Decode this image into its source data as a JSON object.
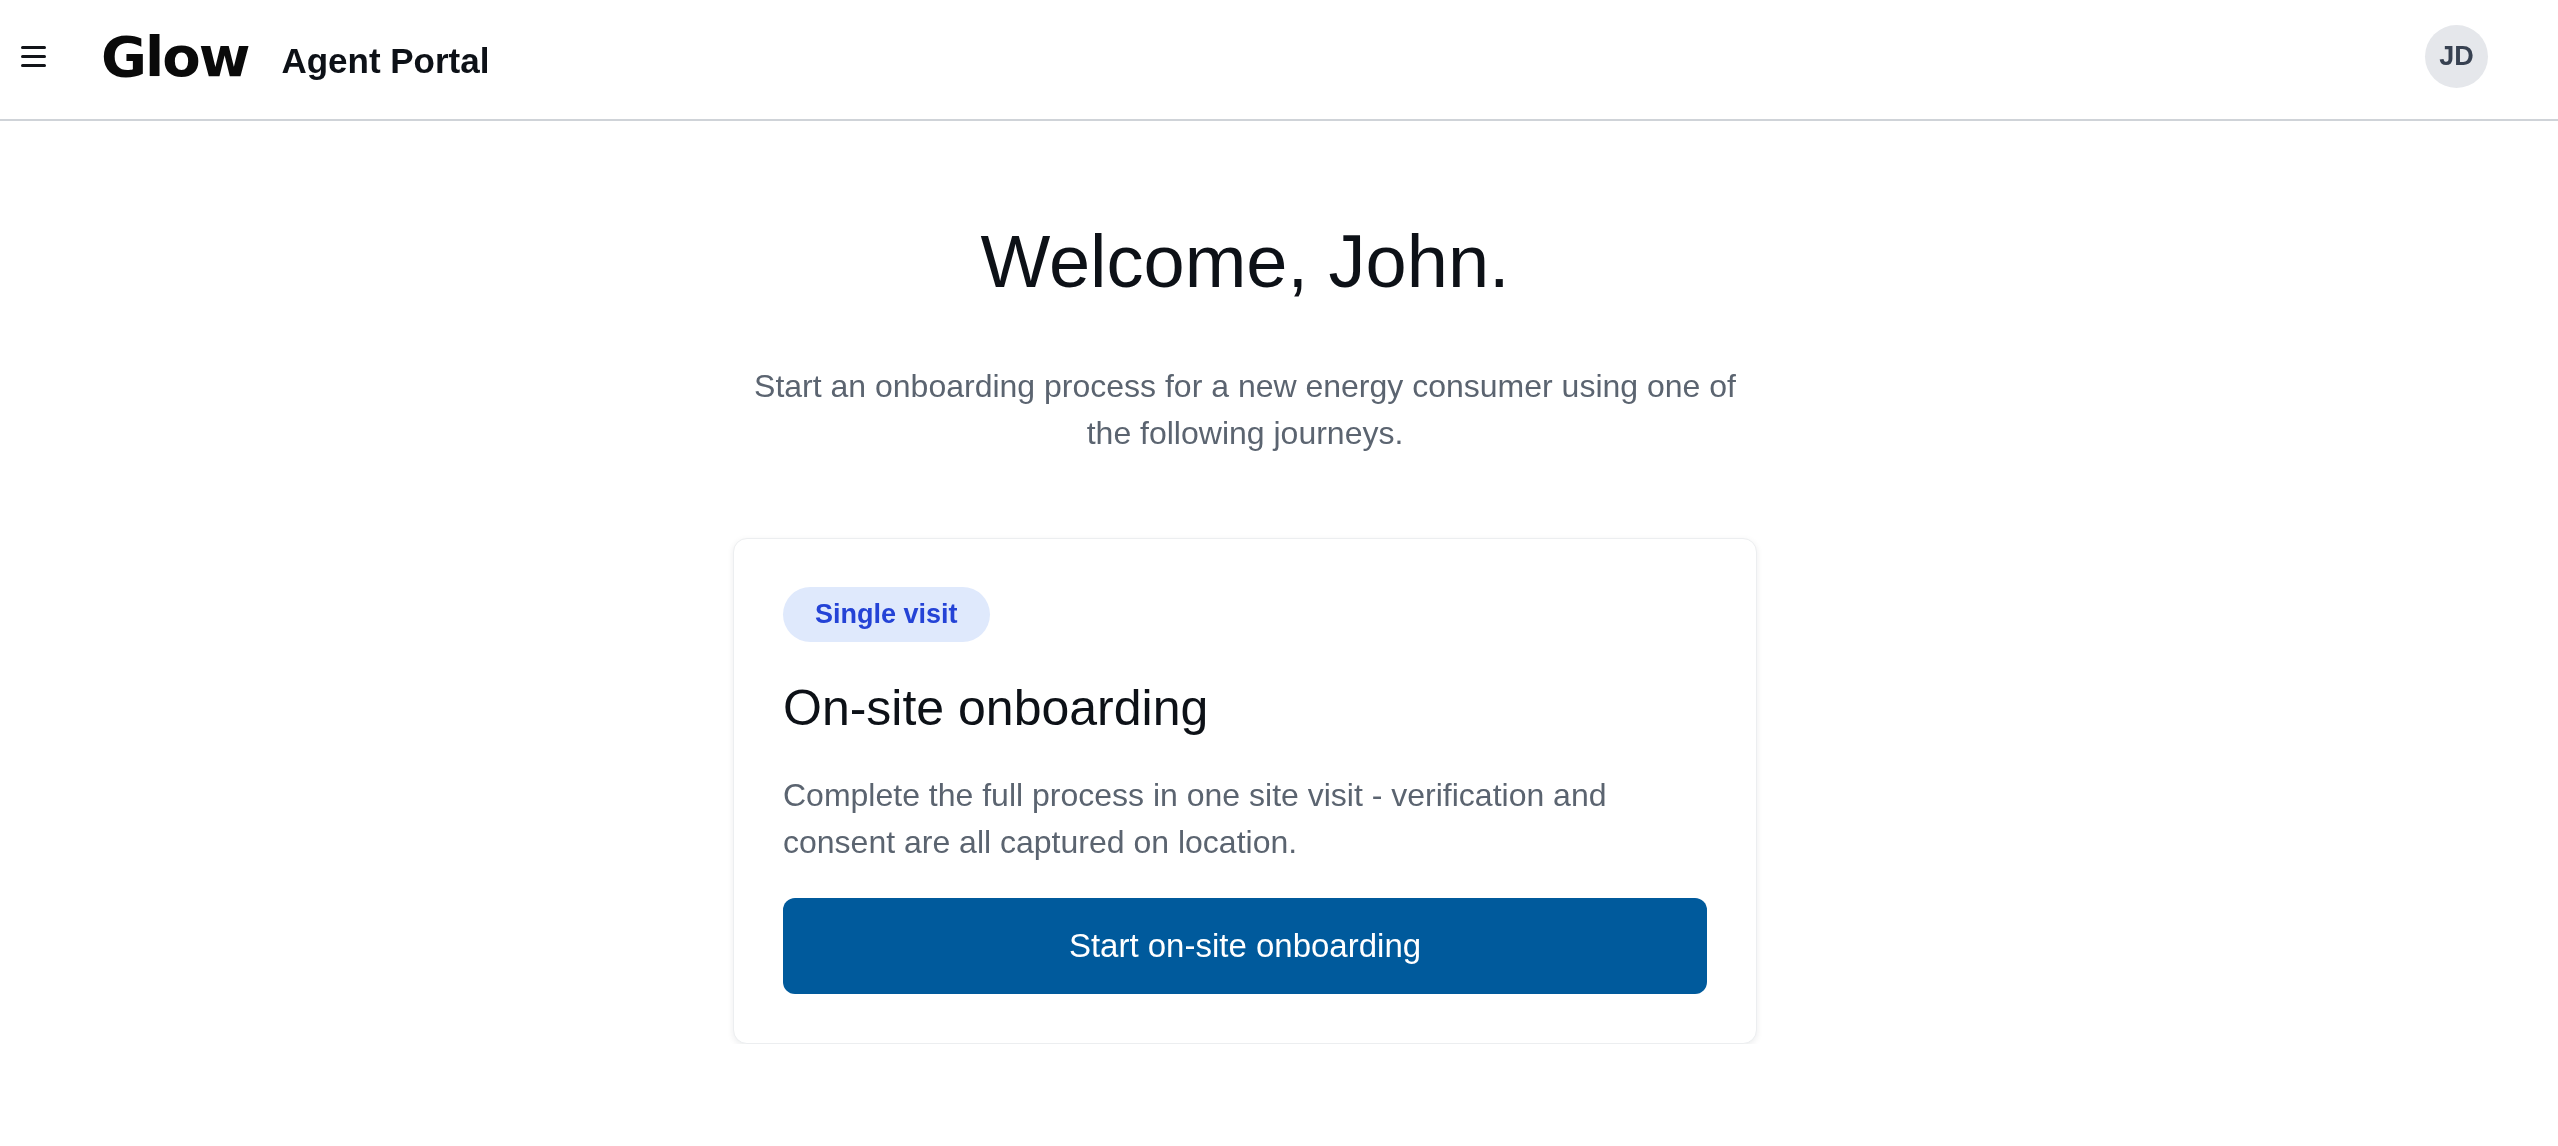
{
  "header": {
    "logo": "Glow",
    "app_title": "Agent Portal",
    "avatar": {
      "initials": "JD"
    }
  },
  "welcome": {
    "title": "Welcome, John.",
    "subtitle": "Start an onboarding process for a new energy consumer using one of the following journeys."
  },
  "journeys": [
    {
      "badge": "Single visit",
      "title": "On-site onboarding",
      "description": "Complete the full process in one site visit - verification and consent are all captured on location.",
      "button": "Start on-site onboarding"
    }
  ]
}
